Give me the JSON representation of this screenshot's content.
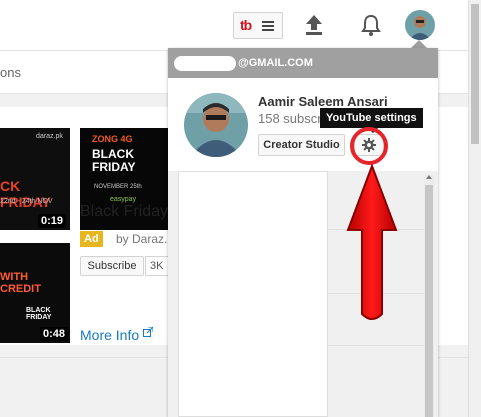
{
  "header": {
    "logo_text": "tb",
    "icons": [
      "tubebuddy-menu-icon",
      "upload-icon",
      "notifications-bell-icon",
      "account-avatar"
    ]
  },
  "subnav": {
    "text": "ons"
  },
  "feed": {
    "thumbnails": [
      {
        "brand": "daraz.pk",
        "headline": "CK FRIDAY",
        "dates": "22nd - 24th NOV",
        "duration": "0:19"
      },
      {
        "brand": "ZONG 4G",
        "headline": "BLACK FRIDAY",
        "date": "NOVEMBER 25th",
        "sponsor": "easypay"
      },
      {
        "headline": "WITH CREDIT",
        "overlay": "BLACK FRIDAY",
        "duration": "0:48"
      }
    ],
    "ad": {
      "title": "Black Friday",
      "badge": "Ad",
      "by": "by Daraz.",
      "subscribe_label": "Subscribe",
      "subscriber_count": "3K",
      "more_info": "More Info"
    }
  },
  "account_menu": {
    "email": "@GMAIL.COM",
    "name": "Aamir Saleem Ansari",
    "subscribers": "158 subscribers",
    "creator_studio_label": "Creator Studio",
    "settings_tooltip": "YouTube settings"
  },
  "colors": {
    "accent_red": "#e4262c",
    "link_blue": "#167ac6",
    "ad_yellow": "#e6b71e",
    "header_gray": "#a0a0a0"
  }
}
